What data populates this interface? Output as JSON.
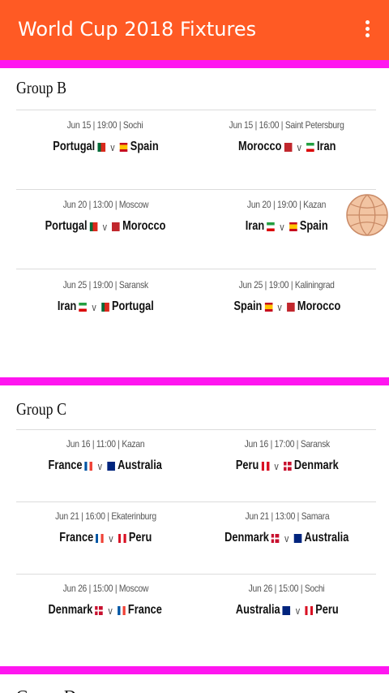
{
  "app": {
    "title": "World Cup 2018 Fixtures",
    "menu_icon": "more-vert-icon"
  },
  "colors": {
    "appbar": "#ff5a24",
    "divider": "#ff16f0"
  },
  "groups": [
    {
      "name": "Group B",
      "matches": [
        {
          "meta": "Jun 15 | 19:00 | Sochi",
          "home": "Portugal",
          "home_flag": "portugal",
          "vs": "v",
          "away": "Spain",
          "away_flag": "spain"
        },
        {
          "meta": "Jun 15 | 16:00 | Saint Petersburg",
          "home": "Morocco",
          "home_flag": "morocco",
          "vs": "v",
          "away": "Iran",
          "away_flag": "iran"
        },
        {
          "meta": "Jun 20 | 13:00 | Moscow",
          "home": "Portugal",
          "home_flag": "portugal",
          "vs": "v",
          "away": "Morocco",
          "away_flag": "morocco"
        },
        {
          "meta": "Jun 20 | 19:00 | Kazan",
          "home": "Iran",
          "home_flag": "iran",
          "vs": "v",
          "away": "Spain",
          "away_flag": "spain"
        },
        {
          "meta": "Jun 25 | 19:00 | Saransk",
          "home": "Iran",
          "home_flag": "iran",
          "vs": "v",
          "away": "Portugal",
          "away_flag": "portugal"
        },
        {
          "meta": "Jun 25 | 19:00 | Kaliningrad",
          "home": "Spain",
          "home_flag": "spain",
          "vs": "v",
          "away": "Morocco",
          "away_flag": "morocco"
        }
      ]
    },
    {
      "name": "Group C",
      "matches": [
        {
          "meta": "Jun 16 | 11:00 | Kazan",
          "home": "France",
          "home_flag": "france",
          "vs": "v",
          "away": "Australia",
          "away_flag": "australia"
        },
        {
          "meta": "Jun 16 | 17:00 | Saransk",
          "home": "Peru",
          "home_flag": "peru",
          "vs": "v",
          "away": "Denmark",
          "away_flag": "denmark"
        },
        {
          "meta": "Jun 21 | 16:00 | Ekaterinburg",
          "home": "France",
          "home_flag": "france",
          "vs": "v",
          "away": "Peru",
          "away_flag": "peru"
        },
        {
          "meta": "Jun 21 | 13:00 | Samara",
          "home": "Denmark",
          "home_flag": "denmark",
          "vs": "v",
          "away": "Australia",
          "away_flag": "australia"
        },
        {
          "meta": "Jun 26 | 15:00 | Moscow",
          "home": "Denmark",
          "home_flag": "denmark",
          "vs": "v",
          "away": "France",
          "away_flag": "france"
        },
        {
          "meta": "Jun 26 | 15:00 | Sochi",
          "home": "Australia",
          "home_flag": "australia",
          "vs": "v",
          "away": "Peru",
          "away_flag": "peru"
        }
      ]
    }
  ],
  "next_group_partial": "Group D",
  "floating_icon": "basketball-icon"
}
